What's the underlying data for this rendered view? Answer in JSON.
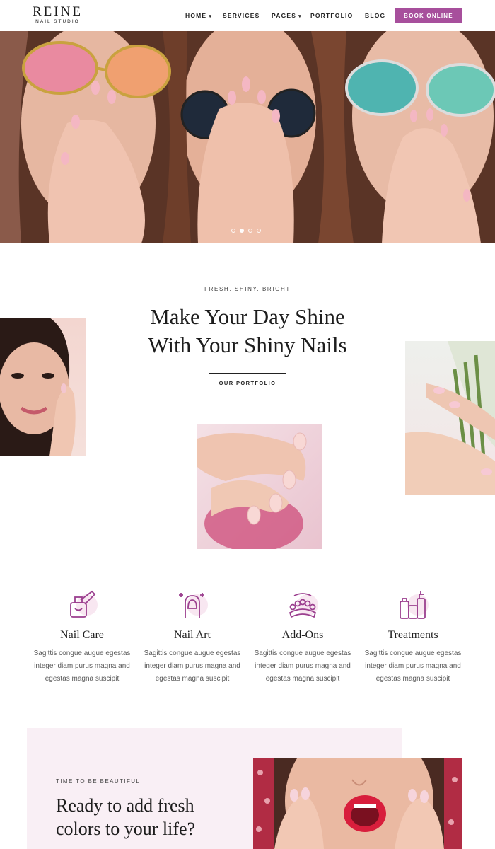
{
  "header": {
    "logo_main": "REINE",
    "logo_sub": "NAIL STUDIO",
    "nav": [
      {
        "label": "HOME",
        "has_caret": true
      },
      {
        "label": "SERVICES",
        "has_caret": false
      },
      {
        "label": "PAGES",
        "has_caret": true
      },
      {
        "label": "PORTFOLIO",
        "has_caret": false
      },
      {
        "label": "BLOG",
        "has_caret": false
      }
    ],
    "book_button": "BOOK ONLINE"
  },
  "hero": {
    "slide_count": 4,
    "active_slide": 2
  },
  "intro": {
    "eyebrow": "FRESH, SHINY, BRIGHT",
    "headline_line1": "Make Your Day Shine",
    "headline_line2": "With Your Shiny Nails",
    "button": "OUR PORTFOLIO"
  },
  "services": [
    {
      "title": "Nail Care",
      "icon": "nail-polish-icon",
      "desc1": "Sagittis congue augue egestas",
      "desc2": "integer diam purus magna and",
      "desc3": "egestas magna suscipit"
    },
    {
      "title": "Nail Art",
      "icon": "nail-art-icon",
      "desc1": "Sagittis congue augue egestas",
      "desc2": "integer diam purus magna and",
      "desc3": "egestas magna suscipit"
    },
    {
      "title": "Add-Ons",
      "icon": "toe-separator-icon",
      "desc1": "Sagittis congue augue egestas",
      "desc2": "integer diam purus magna and",
      "desc3": "egestas magna suscipit"
    },
    {
      "title": "Treatments",
      "icon": "cosmetics-bottles-icon",
      "desc1": "Sagittis congue augue egestas",
      "desc2": "integer diam purus magna and",
      "desc3": "egestas magna suscipit"
    }
  ],
  "cta": {
    "eyebrow": "TIME TO BE BEAUTIFUL",
    "title_line1": "Ready to add fresh",
    "title_line2": "colors to your life?"
  },
  "colors": {
    "accent": "#a74f9c",
    "icon_stroke": "#9b3f8f",
    "icon_blob": "#f8e7f1",
    "cta_background": "#f9eff5"
  }
}
